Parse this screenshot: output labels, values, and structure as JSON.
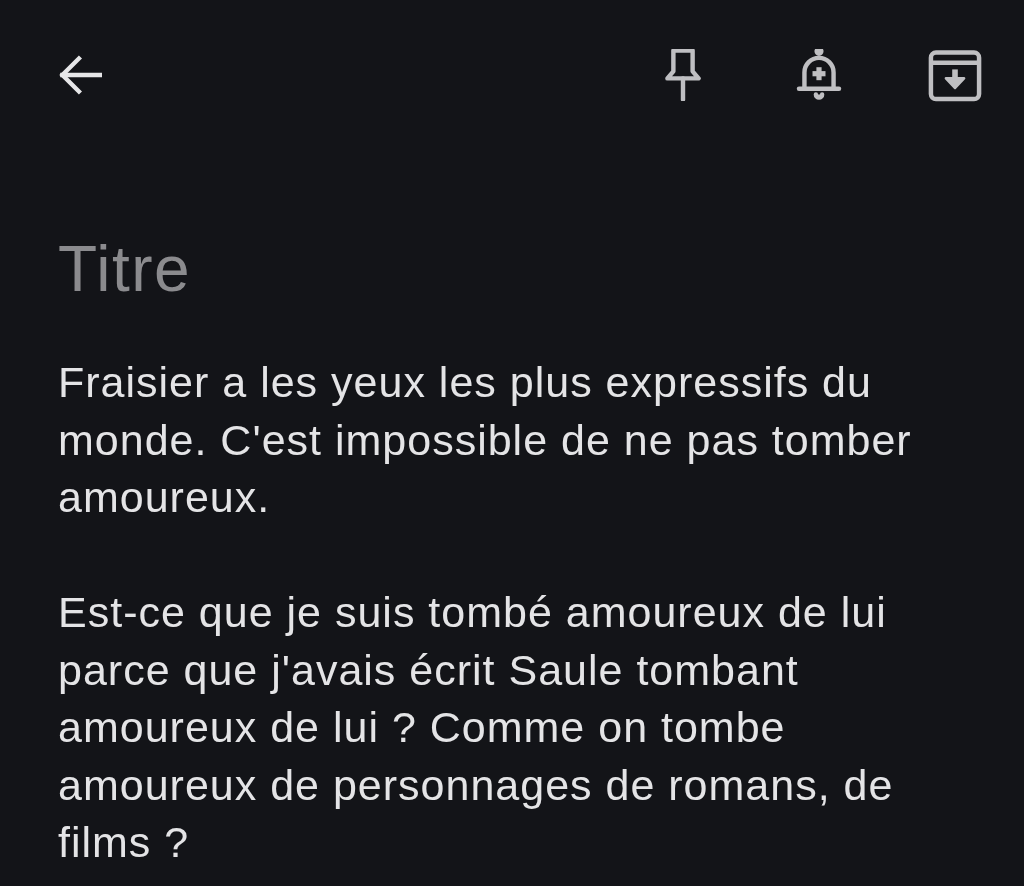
{
  "toolbar": {
    "navigation": {
      "kind": "back"
    },
    "actions": [
      {
        "kind": "pin"
      },
      {
        "kind": "reminder"
      },
      {
        "kind": "archive"
      }
    ]
  },
  "note": {
    "title": {
      "placeholder": "Titre"
    },
    "body": {
      "value": "Fraisier a les yeux les plus expressifs du monde. C'est impossible de ne pas tomber amoureux.\n\nEst-ce que je suis tombé amoureux de lui parce que j'avais écrit Saule tombant amoureux de lui ? Comme on tombe amoureux de personnages de romans, de films ?"
    }
  }
}
